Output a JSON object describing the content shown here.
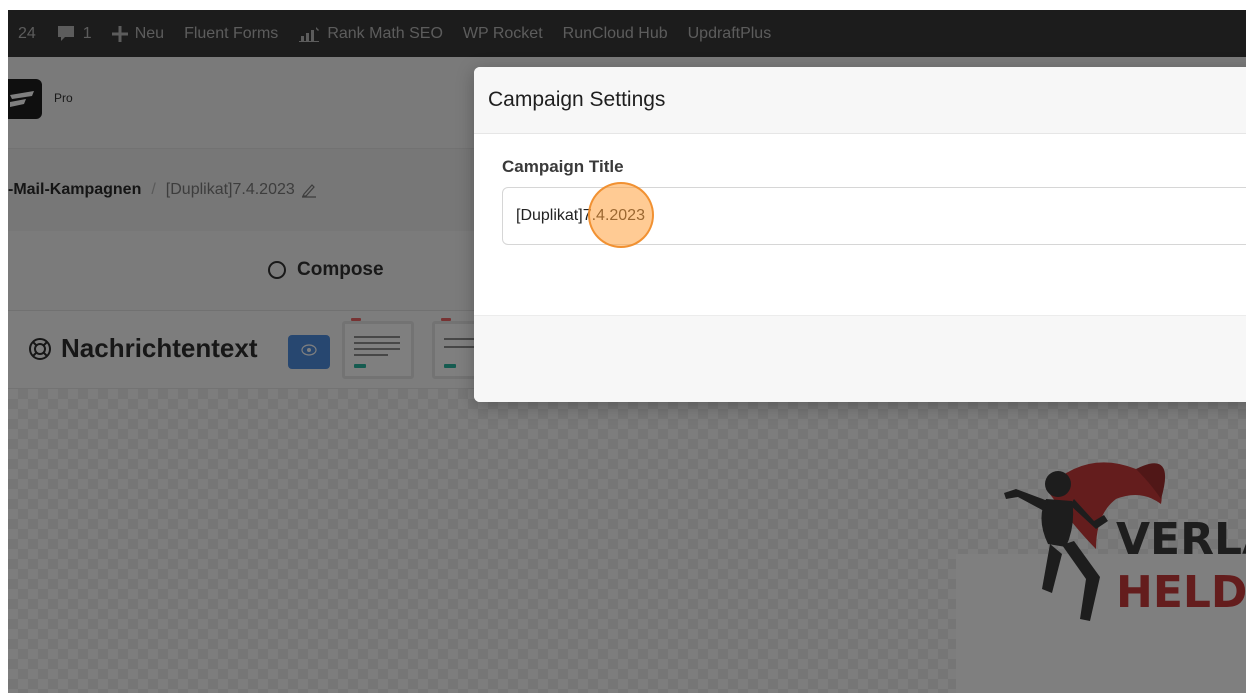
{
  "admin_bar": {
    "updates_count": "24",
    "comments_count": "1",
    "new_label": "Neu",
    "menu_items": [
      "Fluent Forms",
      "Rank Math SEO",
      "WP Rocket",
      "RunCloud Hub",
      "UpdraftPlus"
    ]
  },
  "plugin_header": {
    "badge": "Pro"
  },
  "breadcrumb": {
    "parent": "-Mail-Kampagnen",
    "separator": "/",
    "current": "[Duplikat]7.4.2023"
  },
  "steps": {
    "compose": "Compose"
  },
  "editor": {
    "section_title": "Nachrichtentext"
  },
  "logo": {
    "line1": "VERLA",
    "line2": "HELDEN"
  },
  "modal": {
    "title": "Campaign Settings",
    "field_label": "Campaign Title",
    "field_value": "[Duplikat]7.4.2023"
  },
  "colors": {
    "admin_bar_bg": "#383838",
    "accent_blue": "#4e8fe0",
    "click_marker": "#ffa03c",
    "logo_red": "#c83a3a"
  }
}
